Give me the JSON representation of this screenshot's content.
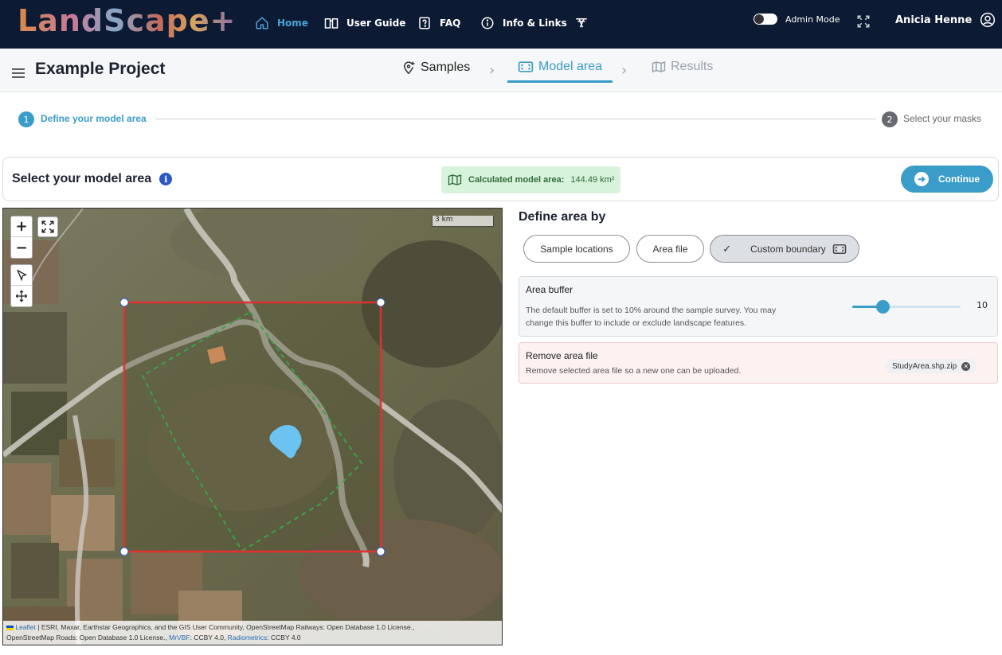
{
  "app": {
    "logo": "LandScape+"
  },
  "topnav": {
    "items": [
      {
        "label": "Home",
        "icon": "home-icon",
        "active": true
      },
      {
        "label": "User Guide",
        "icon": "book-icon"
      },
      {
        "label": "FAQ",
        "icon": "question-icon"
      },
      {
        "label": "Info & Links",
        "icon": "info-icon"
      },
      {
        "label": "",
        "icon": "translate-icon"
      }
    ],
    "admin_mode": "Admin Mode",
    "user": "Anicia Henne"
  },
  "project": {
    "title": "Example Project",
    "tabs": [
      {
        "label": "Samples",
        "icon": "location-plus-icon",
        "state": "done"
      },
      {
        "label": "Model area",
        "icon": "area-select-icon",
        "state": "active"
      },
      {
        "label": "Results",
        "icon": "map-icon",
        "state": "disabled"
      }
    ]
  },
  "stepper": {
    "steps": [
      {
        "num": "1",
        "label": "Define your model area",
        "active": true
      },
      {
        "num": "2",
        "label": "Select your masks",
        "active": false
      }
    ]
  },
  "select_bar": {
    "title": "Select your model area",
    "info": "i",
    "calc_label": "Calculated model area:",
    "calc_value": "144.49 km²",
    "continue": "Continue"
  },
  "map": {
    "scale": "3 km",
    "zoom_in": "+",
    "zoom_out": "−",
    "attribution_leaflet": "Leaflet",
    "attribution_line1": " | ESRI, Maxar, Earthstar Geographics, and the GIS User Community, OpenStreetMap Railways: Open Database 1.0 License.,",
    "attribution_line2a": "OpenStreetMap Roads: Open Database 1.0 License., ",
    "attribution_mrvbf": "MrVBF",
    "attribution_line2b": ": CCBY 4.0, ",
    "attribution_radiometrics": "Radiometrics",
    "attribution_line2c": ": CCBY 4.0"
  },
  "define": {
    "title": "Define area by",
    "options": [
      {
        "label": "Sample locations",
        "selected": false
      },
      {
        "label": "Area file",
        "selected": false
      },
      {
        "label": "Custom boundary",
        "selected": true
      }
    ]
  },
  "buffer": {
    "title": "Area buffer",
    "desc_line1": "The default buffer is set to 10% around the sample survey. You may",
    "desc_line2": "change this buffer to include or exclude landscape features.",
    "value": "10",
    "fraction": 0.28
  },
  "remove_file": {
    "title": "Remove area file",
    "desc": "Remove selected area file so a new one can be uploaded.",
    "file_name": "StudyArea.shp.zip"
  },
  "colors": {
    "accent": "#3a9cc9",
    "nav_bg": "#0d1a33",
    "boundary": "#e03030",
    "success_bg": "#d8f3dc",
    "danger_bg": "#fdf1f1"
  }
}
